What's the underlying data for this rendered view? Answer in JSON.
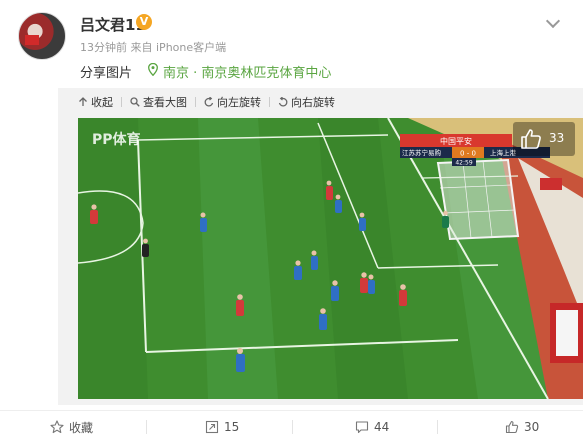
{
  "post": {
    "username": "吕文君11",
    "verified_badge": "V",
    "time": "13分钟前",
    "source_prefix": "来自",
    "source": "iPhone客户端",
    "text": "分享图片",
    "location_icon": "location-pin-icon",
    "location": "南京 · 南京奥林匹克体育中心"
  },
  "toolbar": {
    "collapse_label": "收起",
    "view_large_label": "查看大图",
    "rotate_left_label": "向左旋转",
    "rotate_right_label": "向右旋转"
  },
  "image": {
    "broadcaster_logo": "PP体育",
    "scoreboard": {
      "sponsor": "中国平安",
      "home_team": "江苏苏宁易购",
      "score": "0 - 0",
      "away_team": "上海上港",
      "clock": "42:59"
    },
    "like_count": "33"
  },
  "footer": {
    "favorite_label": "收藏",
    "repost_count": "15",
    "comment_count": "44",
    "like_count": "30"
  },
  "colors": {
    "accent_green": "#5aa541",
    "verified_orange": "#f5a623",
    "pitch_green": "#3f8d2f"
  }
}
